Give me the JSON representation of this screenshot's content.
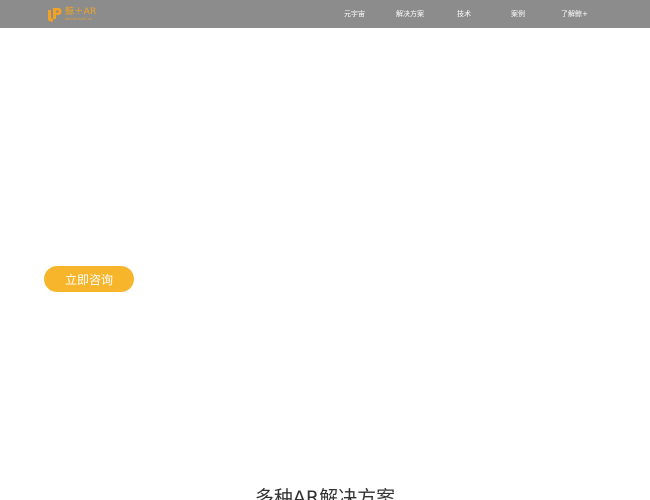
{
  "header": {
    "logo_name": "鲸＋AR",
    "logo_sub": "WHALE PLUS AR",
    "logo_color": "#f3a321",
    "background_color": "#8c8c8c",
    "nav": [
      {
        "label": "元宇宙"
      },
      {
        "label": "解决方案"
      },
      {
        "label": "技术"
      },
      {
        "label": "案例"
      },
      {
        "label": "了解鲸+"
      }
    ]
  },
  "hero": {
    "cta_label": "立即咨询",
    "cta_color": "#f7b52c"
  },
  "section": {
    "title": "多种AR解决方案"
  }
}
